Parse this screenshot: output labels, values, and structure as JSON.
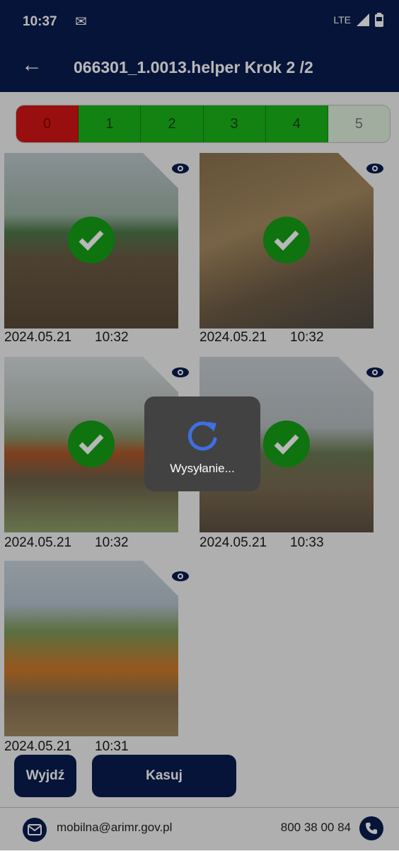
{
  "status_bar": {
    "time": "10:37",
    "network": "LTE"
  },
  "app_bar": {
    "title": "066301_1.0013.helper Krok 2 /2"
  },
  "steps": [
    {
      "label": "0",
      "state": "red"
    },
    {
      "label": "1",
      "state": "green"
    },
    {
      "label": "2",
      "state": "green"
    },
    {
      "label": "3",
      "state": "green"
    },
    {
      "label": "4",
      "state": "green"
    },
    {
      "label": "5",
      "state": "light"
    }
  ],
  "photos": [
    {
      "date": "2024.05.21",
      "time": "10:32",
      "status": "sent"
    },
    {
      "date": "2024.05.21",
      "time": "10:32",
      "status": "sent"
    },
    {
      "date": "2024.05.21",
      "time": "10:32",
      "status": "sent"
    },
    {
      "date": "2024.05.21",
      "time": "10:33",
      "status": "sent"
    },
    {
      "date": "2024.05.21",
      "time": "10:31",
      "status": "pending"
    }
  ],
  "dialog": {
    "label": "Wysyłanie..."
  },
  "buttons": {
    "exit": "Wyjdź",
    "delete": "Kasuj"
  },
  "footer": {
    "email": "mobilna@arimr.gov.pl",
    "phone": "800 38 00 84"
  },
  "colors": {
    "brand": "#0a1d4f",
    "success": "#16a016",
    "error": "#d41515"
  }
}
